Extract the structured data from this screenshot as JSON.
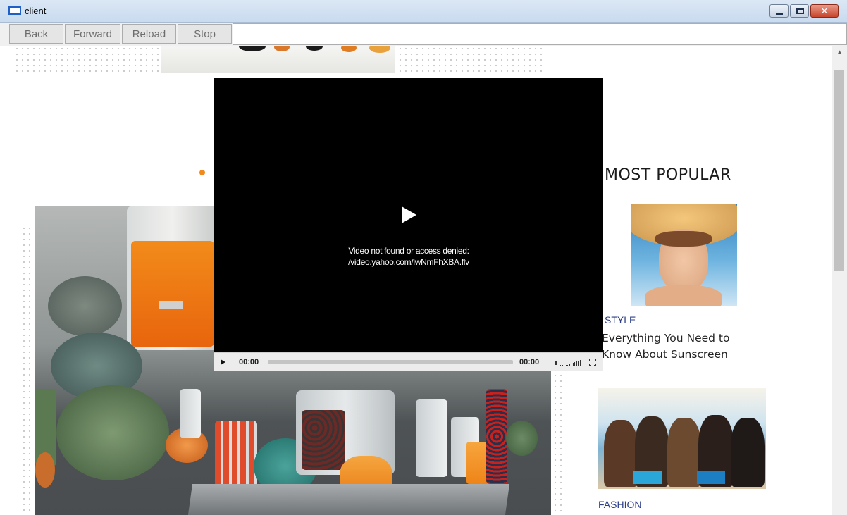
{
  "window": {
    "title": "client",
    "buttons": [
      "minimize",
      "maximize",
      "close"
    ]
  },
  "nav": {
    "back_label": "Back",
    "forward_label": "Forward",
    "reload_label": "Reload",
    "stop_label": "Stop",
    "url_value": ""
  },
  "video": {
    "error_line1": "Video not found or access denied:",
    "error_line2": "/video.yahoo.com/iwNmFhXBA.flv",
    "time_current": "00:00",
    "time_total": "00:00",
    "progress": 0
  },
  "sidebar": {
    "heading": "MOST POPULAR",
    "cards": [
      {
        "category": "STYLE",
        "title": "Everything You Need to Know About Sunscreen"
      },
      {
        "category": "FASHION"
      }
    ]
  },
  "colors": {
    "accent_dot": "#f08a1c",
    "category_text": "#2d3f8a",
    "player_bg": "#000000"
  },
  "icons": [
    "app-window-icon",
    "minimize-icon",
    "maximize-icon",
    "close-icon",
    "play-icon",
    "volume-icon",
    "fullscreen-icon",
    "scroll-up-arrow-icon"
  ]
}
